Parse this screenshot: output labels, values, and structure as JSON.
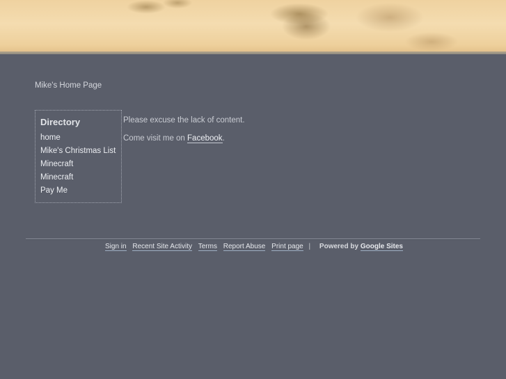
{
  "site": {
    "title": "Mike's Home Page"
  },
  "sidebar": {
    "heading": "Directory",
    "items": [
      {
        "label": "home"
      },
      {
        "label": "Mike's Christmas List"
      },
      {
        "label": "Minecraft"
      },
      {
        "label": "Minecraft"
      },
      {
        "label": "Pay Me"
      }
    ]
  },
  "content": {
    "line1": "Please excuse the lack of content.",
    "line2_prefix": "Come visit me on ",
    "line2_link": "Facebook",
    "line2_suffix": "."
  },
  "footer": {
    "links": [
      "Sign in",
      "Recent Site Activity",
      "Terms",
      "Report Abuse",
      "Print page"
    ],
    "separator": "|",
    "powered_prefix": "Powered by",
    "powered_link": "Google Sites"
  },
  "colors": {
    "background": "#5a5e6a",
    "banner_sand": "#efd2a0",
    "text": "#d0d2d8"
  }
}
